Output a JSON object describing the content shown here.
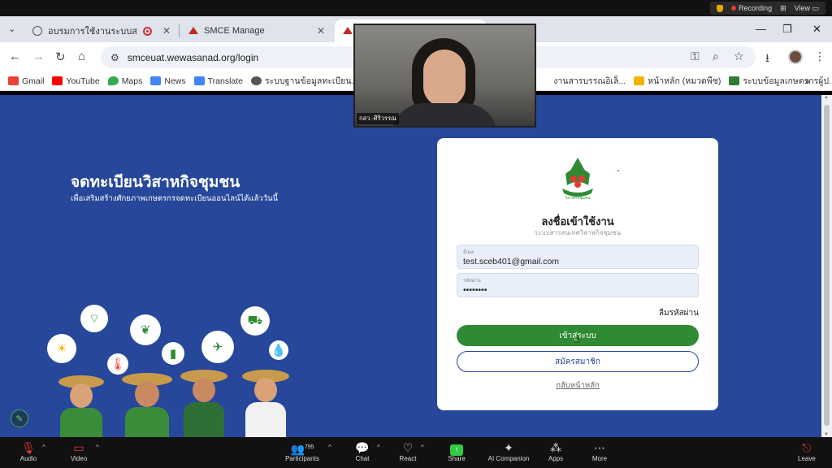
{
  "zoom_top": {
    "recording": "Recording",
    "view": "View"
  },
  "tabs": [
    {
      "label": "อบรมการใช้งานระบบสารสนเทศวิ",
      "active": false
    },
    {
      "label": "SMCE Manage",
      "active": false
    },
    {
      "label": "",
      "active": true
    }
  ],
  "address_bar": {
    "url": "smceuat.wewasanad.org/login"
  },
  "bookmarks": [
    {
      "label": "Gmail",
      "color": "#ea4335"
    },
    {
      "label": "YouTube",
      "color": "#ff0000"
    },
    {
      "label": "Maps",
      "color": "#34a853"
    },
    {
      "label": "News",
      "color": "#4285f4"
    },
    {
      "label": "Translate",
      "color": "#4285f4"
    },
    {
      "label": "ระบบฐานข้อมูลทะเบียน...",
      "color": "#555555"
    },
    {
      "label": "งานสารบรรณอิเล็...",
      "color": "#555555"
    },
    {
      "label": "หน้าหลัก (หมวดพืช)",
      "color": "#f4b400"
    },
    {
      "label": "ระบบข้อมูลเกษตรกรผู้ป...",
      "color": "#2e7d32"
    }
  ],
  "hero": {
    "title": "จดทะเบียนวิสาหกิจชุมชน",
    "subtitle": "เพื่อเสริมสร้างศักยภาพเกษตรกรจดทะเบียนออนไลน์ได้แล้ววันนี้"
  },
  "login": {
    "logo_text": "วิสาหกิจชุมชน",
    "title": "ลงชื่อเข้าใช้งาน",
    "subtitle": "ระบบสารสนเทศวิสาหกิจชุมชน",
    "email_label": "อีเมล",
    "email_value": "test.sceb401@gmail.com",
    "password_label": "รหัสผ่าน",
    "password_value": "••••••••",
    "forgot": "ลืมรหัสผ่าน",
    "login_button": "เข้าสู่ระบบ",
    "register_button": "สมัครสมาชิก",
    "back_home": "กลับหน้าหลัก"
  },
  "video": {
    "name": "กสว.-ศิริวรรณ"
  },
  "zoom_bar": {
    "audio": "Audio",
    "video": "Video",
    "participants": "Participants",
    "participants_count": "795",
    "chat": "Chat",
    "react": "React",
    "share": "Share",
    "ai_companion": "AI Companion",
    "apps": "Apps",
    "more": "More",
    "leave": "Leave"
  },
  "colors": {
    "page_bg": "#27479a",
    "login_green": "#2e8b33",
    "register_border": "#27479a"
  }
}
